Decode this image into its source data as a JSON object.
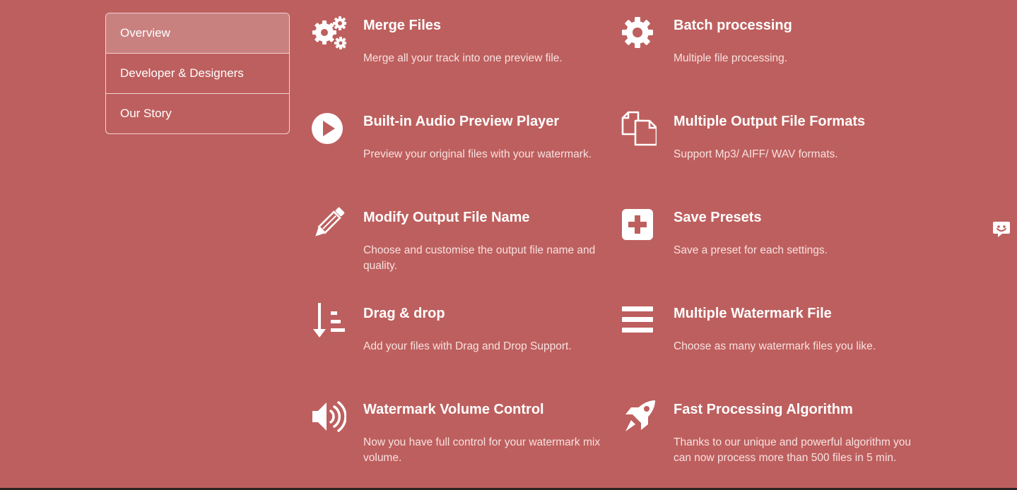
{
  "sidebar": {
    "items": [
      {
        "label": "Overview",
        "active": true
      },
      {
        "label": "Developer & Designers",
        "active": false
      },
      {
        "label": "Our Story",
        "active": false
      }
    ]
  },
  "features": [
    {
      "icon": "gears-icon",
      "title": "Merge Files",
      "desc": "Merge all your track into one preview file."
    },
    {
      "icon": "gear-icon",
      "title": "Batch processing",
      "desc": "Multiple file processing."
    },
    {
      "icon": "play-icon",
      "title": "Built-in Audio Preview Player",
      "desc": "Preview your original files with your watermark."
    },
    {
      "icon": "copy-files-icon",
      "title": "Multiple Output File Formats",
      "desc": "Support Mp3/ AIFF/ WAV formats."
    },
    {
      "icon": "pencil-icon",
      "title": "Modify Output File Name",
      "desc": "Choose and customise the output file name and quality."
    },
    {
      "icon": "plus-square-icon",
      "title": "Save Presets",
      "desc": "Save a preset for each settings."
    },
    {
      "icon": "sort-down-icon",
      "title": "Drag & drop",
      "desc": "Add your files with Drag and Drop Support."
    },
    {
      "icon": "list-bars-icon",
      "title": "Multiple Watermark File",
      "desc": "Choose as many watermark files you like."
    },
    {
      "icon": "volume-icon",
      "title": "Watermark Volume Control",
      "desc": "Now you have full control for your watermark mix volume."
    },
    {
      "icon": "rocket-icon",
      "title": "Fast Processing Algorithm",
      "desc": "Thanks to our unique and powerful algorithm you can now process more than 500 files in 5 min."
    }
  ],
  "colors": {
    "background": "#bd5f5e",
    "active_nav": "#c98180",
    "text": "#ffffff"
  },
  "chat_widget": {
    "icon": "chat-icon"
  }
}
